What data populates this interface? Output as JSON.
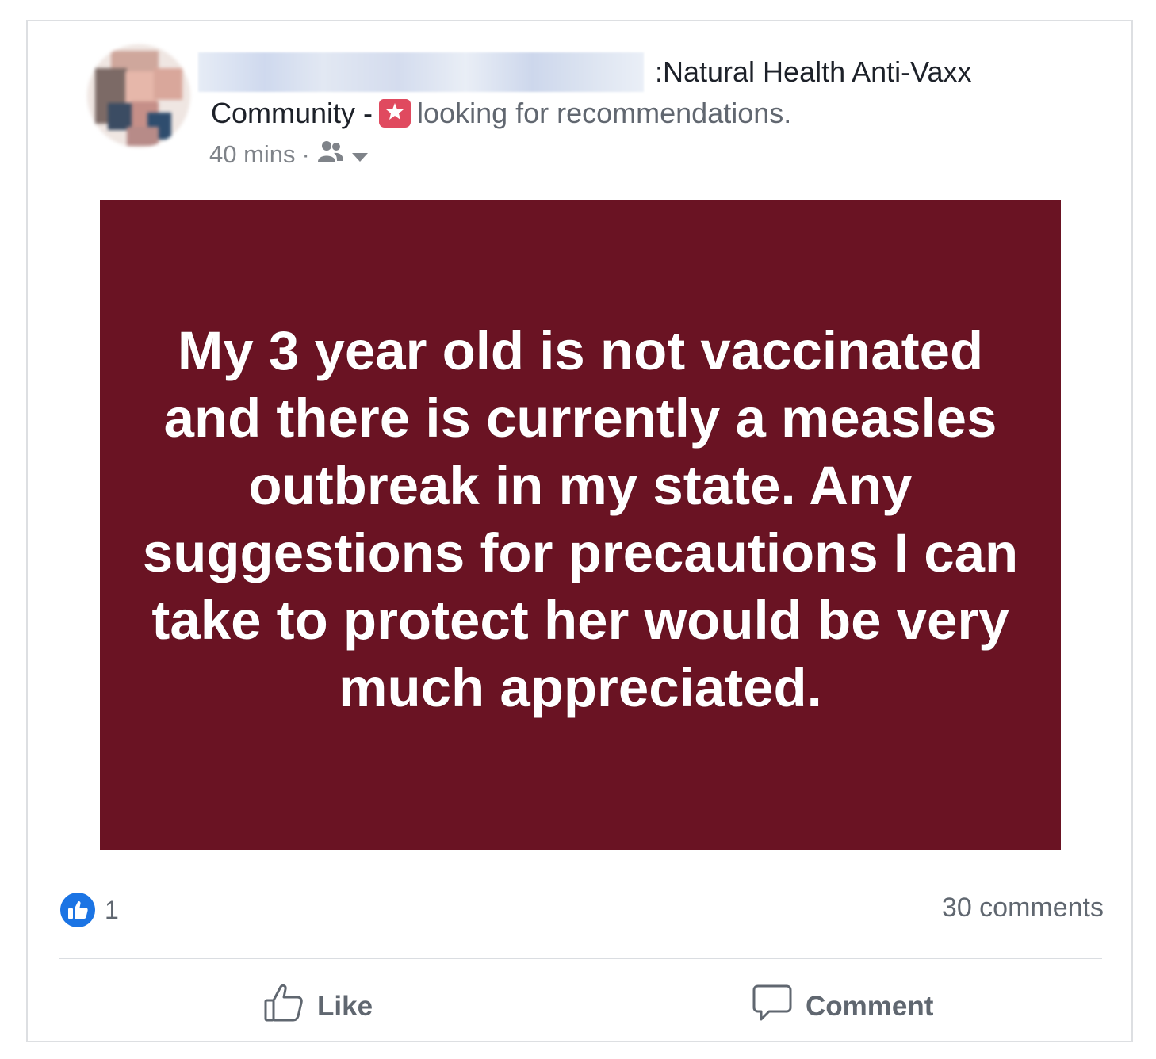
{
  "post": {
    "group_line1": ":Natural Health Anti-Vaxx",
    "group_line2_a": "Community - ",
    "group_line2_b": "looking for recommendations.",
    "time": "40 mins",
    "separator": "·",
    "image_text": "My 3 year old is not vaccinated and there is currently a measles outbreak in my state. Any suggestions for precautions I can take to protect her would be very much appreciated.",
    "reaction_count": "1",
    "comments_count": "30 comments"
  },
  "actions": {
    "like_label": "Like",
    "comment_label": "Comment"
  },
  "icons": {
    "feeling": "star-feeling-icon",
    "audience": "friends-audience-icon",
    "dropdown": "chevron-down-icon",
    "reaction": "like-reaction-icon",
    "like": "thumbs-up-icon",
    "comment": "comment-bubble-icon"
  },
  "colors": {
    "image_background": "#6a1323",
    "feeling_icon": "#e04a5f",
    "like_blue": "#1b74e4"
  }
}
